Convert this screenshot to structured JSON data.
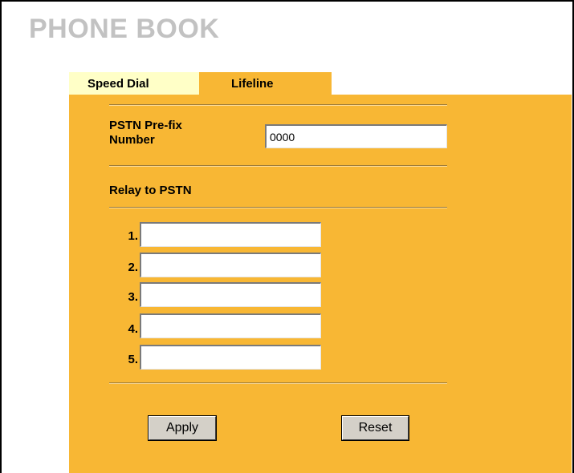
{
  "page": {
    "title": "PHONE BOOK"
  },
  "tabs": [
    {
      "label": "Speed Dial",
      "active": false
    },
    {
      "label": "Lifeline",
      "active": true
    }
  ],
  "form": {
    "prefix_label_line1": "PSTN Pre-fix",
    "prefix_label_line2": "Number",
    "prefix_value": "0000",
    "relay_heading": "Relay to PSTN",
    "relay_entries": [
      {
        "index": "1.",
        "value": ""
      },
      {
        "index": "2.",
        "value": ""
      },
      {
        "index": "3.",
        "value": ""
      },
      {
        "index": "4.",
        "value": ""
      },
      {
        "index": "5.",
        "value": ""
      }
    ]
  },
  "buttons": {
    "apply": "Apply",
    "reset": "Reset"
  },
  "colors": {
    "panel": "#f8b734",
    "inactive_tab": "#ffffc7",
    "title": "#c2c2c2"
  }
}
